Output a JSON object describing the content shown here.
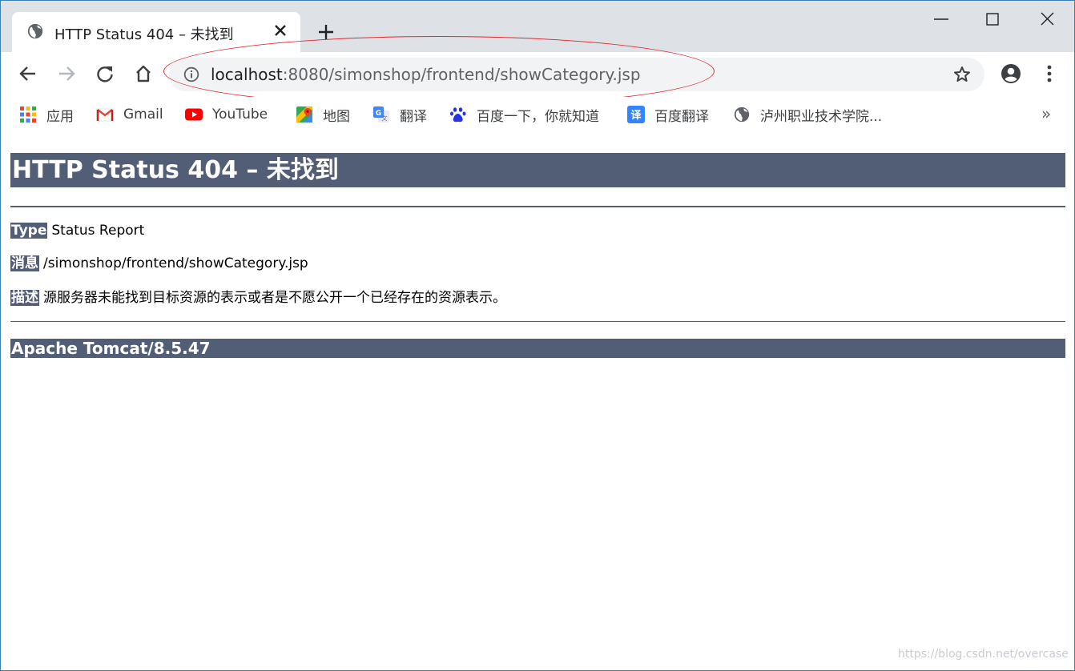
{
  "browser": {
    "tab": {
      "title": "HTTP Status 404 – 未找到"
    },
    "omnibox": {
      "url_host": "localhost",
      "url_rest": ":8080/simonshop/frontend/showCategory.jsp"
    },
    "bookmarks": [
      {
        "label": "应用",
        "icon": "apps-grid-icon"
      },
      {
        "label": "Gmail",
        "icon": "gmail-icon"
      },
      {
        "label": "YouTube",
        "icon": "youtube-icon"
      },
      {
        "label": "地图",
        "icon": "maps-icon"
      },
      {
        "label": "翻译",
        "icon": "translate-icon"
      },
      {
        "label": "百度一下，你就知道",
        "icon": "baidu-paw-icon"
      },
      {
        "label": "百度翻译",
        "icon": "baidu-translate-icon"
      },
      {
        "label": "泸州职业技术学院...",
        "icon": "globe-icon"
      }
    ],
    "bookmarks_more": "»"
  },
  "page": {
    "heading": "HTTP Status 404 – 未找到",
    "type_label": "Type",
    "type_value": "Status Report",
    "message_label": "消息",
    "message_value": "/simonshop/frontend/showCategory.jsp",
    "description_label": "描述",
    "description_value": "源服务器未能找到目标资源的表示或者是不愿公开一个已经存在的资源表示。",
    "footer": "Apache Tomcat/8.5.47"
  },
  "watermark": "https://blog.csdn.net/overcase",
  "colors": {
    "tomcat_header_bg": "#525d76",
    "annotation_ellipse": "#e0282f",
    "tab_strip": "#dee1e6"
  }
}
